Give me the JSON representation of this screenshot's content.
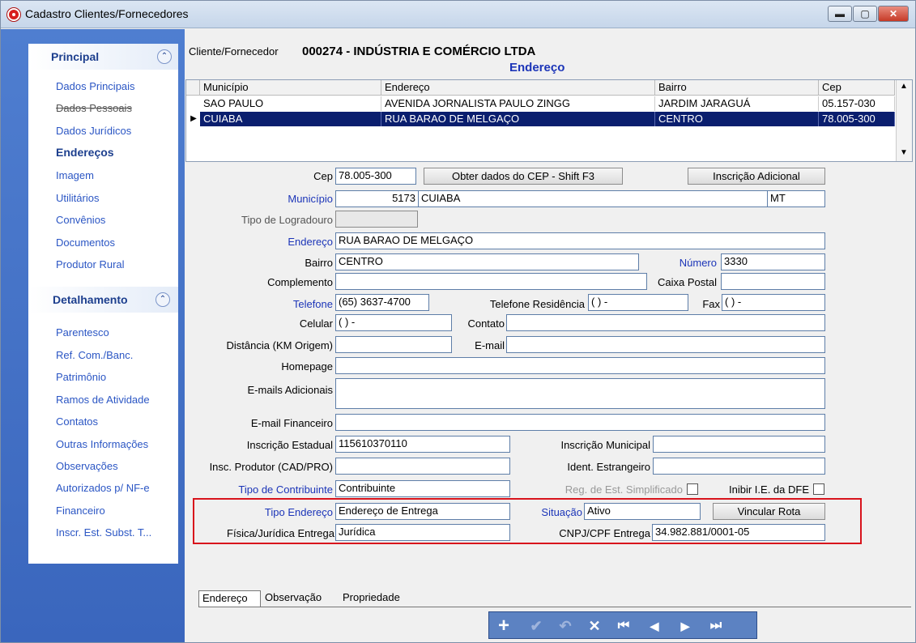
{
  "window": {
    "title": "Cadastro Clientes/Fornecedores",
    "buttons": {
      "minimize": "▬",
      "maximize": "▢",
      "close": "✕"
    }
  },
  "sidebar": {
    "principal": {
      "title": "Principal",
      "collapse": "⌃",
      "items": [
        "Dados Principais",
        "Dados Pessoais",
        "Dados Jurídicos",
        "Endereços",
        "Imagem",
        "Utilitários",
        "Convênios",
        "Documentos",
        "Produtor Rural"
      ]
    },
    "detalhamento": {
      "title": "Detalhamento",
      "collapse": "⌃",
      "items": [
        "Parentesco",
        "Ref. Com./Banc.",
        "Patrimônio",
        "Ramos de Atividade",
        "Contatos",
        "Outras Informações",
        "Observações",
        "Autorizados p/ NF-e",
        "Financeiro",
        "Inscr. Est. Subst. T..."
      ]
    }
  },
  "header": {
    "client_label": "Cliente/Fornecedor",
    "client_value": "000274 - INDÚSTRIA E COMÉRCIO LTDA",
    "section": "Endereço"
  },
  "grid": {
    "columns": [
      "Município",
      "Endereço",
      "Bairro",
      "Cep"
    ],
    "rows": [
      [
        "SAO PAULO",
        "AVENIDA JORNALISTA PAULO ZINGG",
        "JARDIM JARAGUÁ",
        "05.157-030"
      ],
      [
        "CUIABA",
        "RUA BARAO DE MELGAÇO",
        "CENTRO",
        "78.005-300"
      ]
    ]
  },
  "form": {
    "cep_label": "Cep",
    "cep": "78.005-300",
    "obter_button": "Obter dados do CEP - Shift F3",
    "inscricao_adicional_button": "Inscrição Adicional",
    "municipio_label": "Município",
    "municipio_code": "5173",
    "municipio_name": "CUIABA",
    "uf": "MT",
    "tipo_logradouro_label": "Tipo de Logradouro",
    "tipo_logradouro": "",
    "endereco_label": "Endereço",
    "endereco": "RUA BARAO DE MELGAÇO",
    "bairro_label": "Bairro",
    "bairro": "CENTRO",
    "numero_label": "Número",
    "numero": "3330",
    "complemento_label": "Complemento",
    "complemento": "",
    "caixa_postal_label": "Caixa Postal",
    "caixa_postal": "",
    "telefone_label": "Telefone",
    "telefone": "(65) 3637-4700",
    "telefone_res_label": "Telefone Residência",
    "telefone_res": "( )    -",
    "fax_label": "Fax",
    "fax": "( )    -",
    "celular_label": "Celular",
    "celular": "( )    -",
    "contato_label": "Contato",
    "contato": "",
    "distancia_label": "Distância (KM Origem)",
    "distancia": "",
    "email_label": "E-mail",
    "email": "",
    "homepage_label": "Homepage",
    "homepage": "",
    "emails_adicionais_label": "E-mails Adicionais",
    "emails_adicionais": "",
    "email_financeiro_label": "E-mail Financeiro",
    "email_financeiro": "",
    "inscricao_estadual_label": "Inscrição Estadual",
    "inscricao_estadual": "115610370110",
    "inscricao_municipal_label": "Inscrição Municipal",
    "inscricao_municipal": "",
    "insc_produtor_label": "Insc. Produtor (CAD/PRO)",
    "insc_produtor": "",
    "ident_estrangeiro_label": "Ident. Estrangeiro",
    "ident_estrangeiro": "",
    "tipo_contribuinte_label": "Tipo de Contribuinte",
    "tipo_contribuinte": "Contribuinte",
    "reg_simplificado_label": "Reg. de Est. Simplificado",
    "inibir_ie_label": "Inibir I.E. da DFE",
    "tipo_endereco_label": "Tipo Endereço",
    "tipo_endereco": "Endereço de Entrega",
    "situacao_label": "Situação",
    "situacao": "Ativo",
    "vincular_rota_button": "Vincular Rota",
    "fisica_juridica_label": "Física/Jurídica Entrega",
    "fisica_juridica": "Jurídica",
    "cnpj_label": "CNPJ/CPF Entrega",
    "cnpj": "34.982.881/0001-05"
  },
  "tabs": [
    "Endereço",
    "Observação",
    "Propriedade"
  ],
  "navbar": {
    "add": "+",
    "confirm": "✔",
    "undo": "↶",
    "delete": "✕",
    "first": "⏮",
    "prev": "◀",
    "next": "▶",
    "last": "⏭"
  },
  "colors": {
    "sidebar": "#3a66bd",
    "label_blue": "#1c35b8",
    "selected_row": "#0a1e6e",
    "highlight": "#d8141c"
  }
}
